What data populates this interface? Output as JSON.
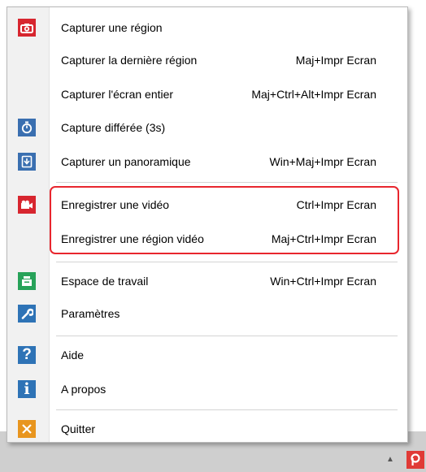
{
  "menu": {
    "items": [
      {
        "label": "Capturer une région",
        "shortcut": "",
        "icon": "camera-icon",
        "color": "#d7262f"
      },
      {
        "label": "Capturer la dernière région",
        "shortcut": "Maj+Impr Ecran",
        "icon": "",
        "color": ""
      },
      {
        "label": "Capturer l'écran entier",
        "shortcut": "Maj+Ctrl+Alt+Impr Ecran",
        "icon": "",
        "color": ""
      },
      {
        "label": "Capture différée (3s)",
        "shortcut": "",
        "icon": "stopwatch-icon",
        "color": "#3a6fb0"
      },
      {
        "label": "Capturer un panoramique",
        "shortcut": "Win+Maj+Impr Ecran",
        "icon": "panorama-icon",
        "color": "#3a6fb0"
      },
      {
        "label": "Enregistrer une vidéo",
        "shortcut": "Ctrl+Impr Ecran",
        "icon": "video-camera-icon",
        "color": "#d7262f"
      },
      {
        "label": "Enregistrer une région vidéo",
        "shortcut": "Maj+Ctrl+Impr Ecran",
        "icon": "",
        "color": ""
      },
      {
        "label": "Espace de travail",
        "shortcut": "Win+Ctrl+Impr Ecran",
        "icon": "workspace-icon",
        "color": "#27a259"
      },
      {
        "label": "Paramètres",
        "shortcut": "",
        "icon": "wrench-icon",
        "color": "#2e73b6"
      },
      {
        "label": "Aide",
        "shortcut": "",
        "icon": "help-icon",
        "color": "#2e73b6"
      },
      {
        "label": "A propos",
        "shortcut": "",
        "icon": "info-icon",
        "color": "#2e73b6"
      },
      {
        "label": "Quitter",
        "shortcut": "",
        "icon": "close-icon",
        "color": "#e8951e"
      }
    ]
  },
  "highlight_color": "#e8262e",
  "taskbar": {
    "tray_icons": [
      "chevron-up-icon",
      "app-tray-icon"
    ]
  }
}
